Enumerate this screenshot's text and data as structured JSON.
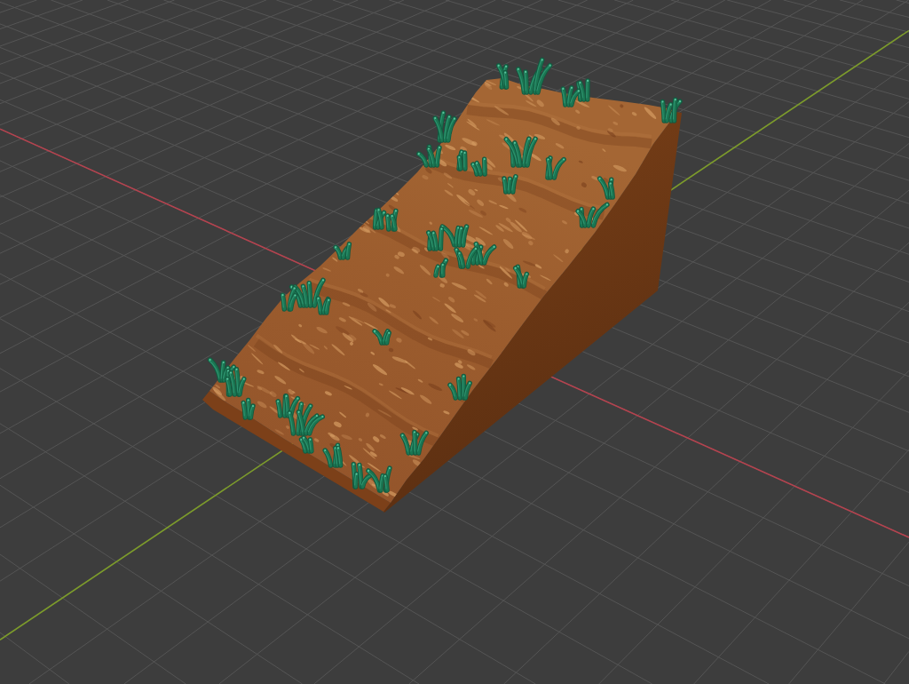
{
  "viewport": {
    "grid": true,
    "axes": [
      {
        "kind": "x",
        "color": "#b5434f"
      },
      {
        "kind": "y",
        "color": "#7c9b2b"
      }
    ],
    "model": {
      "kind": "grassy-dirt-slope"
    }
  }
}
